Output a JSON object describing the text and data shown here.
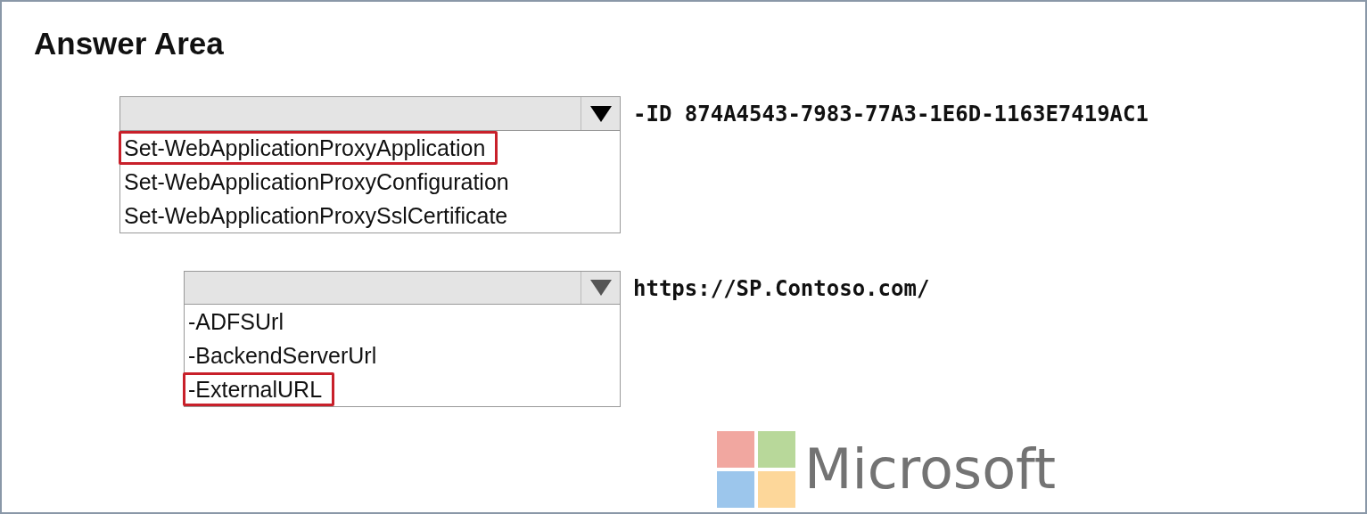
{
  "title": "Answer Area",
  "dropdowns": [
    {
      "options": [
        {
          "label": "Set-WebApplicationProxyApplication",
          "selected": true
        },
        {
          "label": "Set-WebApplicationProxyConfiguration",
          "selected": false
        },
        {
          "label": "Set-WebApplicationProxySslCertificate",
          "selected": false
        }
      ],
      "suffix": "-ID 874A4543-7983-77A3-1E6D-1163E7419AC1"
    },
    {
      "options": [
        {
          "label": "-ADFSUrl",
          "selected": false
        },
        {
          "label": "-BackendServerUrl",
          "selected": false
        },
        {
          "label": "-ExternalURL",
          "selected": true
        }
      ],
      "suffix": "https://SP.Contoso.com/"
    }
  ],
  "logo": {
    "text": "Microsoft"
  }
}
